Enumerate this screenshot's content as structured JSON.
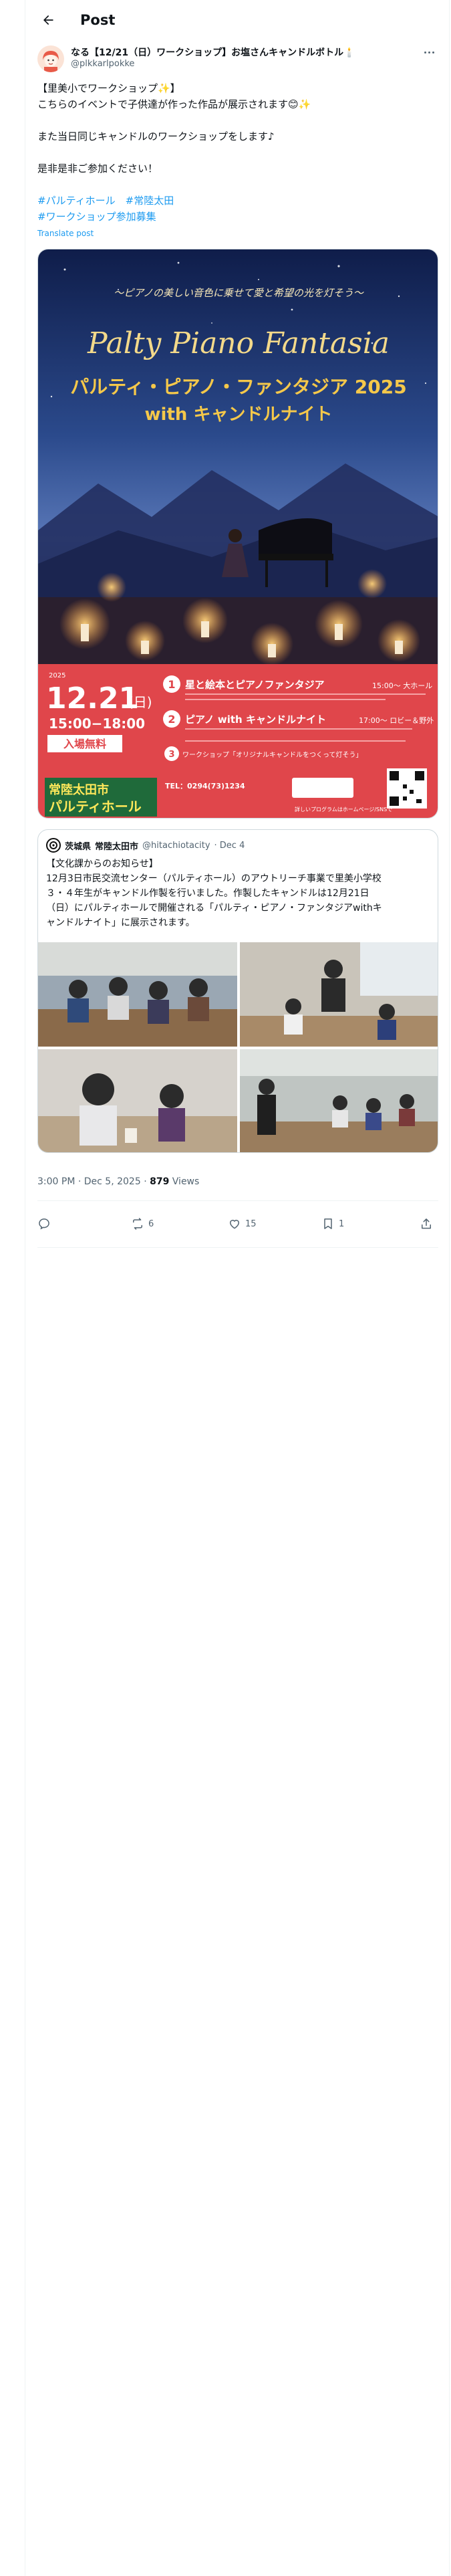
{
  "header": {
    "title": "Post",
    "back_icon": "arrow-left-icon"
  },
  "author": {
    "name": "なる【12/21（日）ワークショップ】お塩さんキャンドルボトル🕯️",
    "handle": "@plkkarlpokke"
  },
  "tweet": {
    "lines": [
      "【里美小でワークショップ✨】",
      "こちらのイベントで子供達が作った作品が展示されます😊✨",
      "また当日同じキャンドルのワークショップをします♪",
      "是非是非ご参加ください！"
    ],
    "hashtags_line1": "#パルティホール　#常陸太田",
    "hashtags_line2": "#ワークショップ参加募集",
    "translate": "Translate post"
  },
  "poster": {
    "subtitle": "〜ピアノの美しい音色に乗せて愛と希望の光を灯そう〜",
    "title_en": "Palty Piano Fantasia",
    "title_jp": "パルティ・ピアノ・ファンタジア 2025",
    "title_with": "with キャンドルナイト",
    "year": "2025",
    "date": "12.21",
    "weekday": "(日)",
    "time": "15:00−18:00",
    "admission": "入場無料",
    "venue_line1": "常陸太田市",
    "venue_line2": "パルティホール",
    "event1_num": "1",
    "event1_title": "星と絵本とピアノファンタジア",
    "event1_time": "15:00〜 大ホール",
    "event2_num": "2",
    "event2_title": "ピアノ with キャンドルナイト",
    "event2_time": "17:00〜 ロビー＆野外",
    "event3_num": "3",
    "event3_title": "ワークショップ「オリジナルキャンドルをつくって灯そう」",
    "tel": "TEL：0294(73)1234",
    "link_label": "詳しいプログラムはホームページ/SNSで",
    "qr_icon": "qr-code-icon"
  },
  "quote": {
    "account_region": "茨城県",
    "name": "常陸太田市",
    "handle": "@hitachiotacity",
    "date": "· Dec 4",
    "text_lines": [
      "【文化課からのお知らせ】",
      "12月3日市民交流センター（パルティホール）のアウトリーチ事業で里美小学校",
      "３・４年生がキャンドル作製を行いました。作製したキャンドルは12月21日",
      "（日）にパルティホールで開催される「パルティ・ピアノ・ファンタジアwithキ",
      "ャンドルナイト」に展示されます。"
    ]
  },
  "meta": {
    "time": "3:00 PM · Dec 5, 2025 · ",
    "views": "879",
    "views_label": " Views"
  },
  "actions": {
    "reply": {
      "icon": "reply-icon",
      "count": ""
    },
    "repost": {
      "icon": "repost-icon",
      "count": "6"
    },
    "like": {
      "icon": "heart-icon",
      "count": "15"
    },
    "bookmark": {
      "icon": "bookmark-icon",
      "count": "1"
    },
    "share": {
      "icon": "share-icon",
      "count": ""
    }
  },
  "colors": {
    "accent": "#1d9bf0",
    "poster_red": "#e0464b",
    "poster_night": "#1e2d5c"
  }
}
